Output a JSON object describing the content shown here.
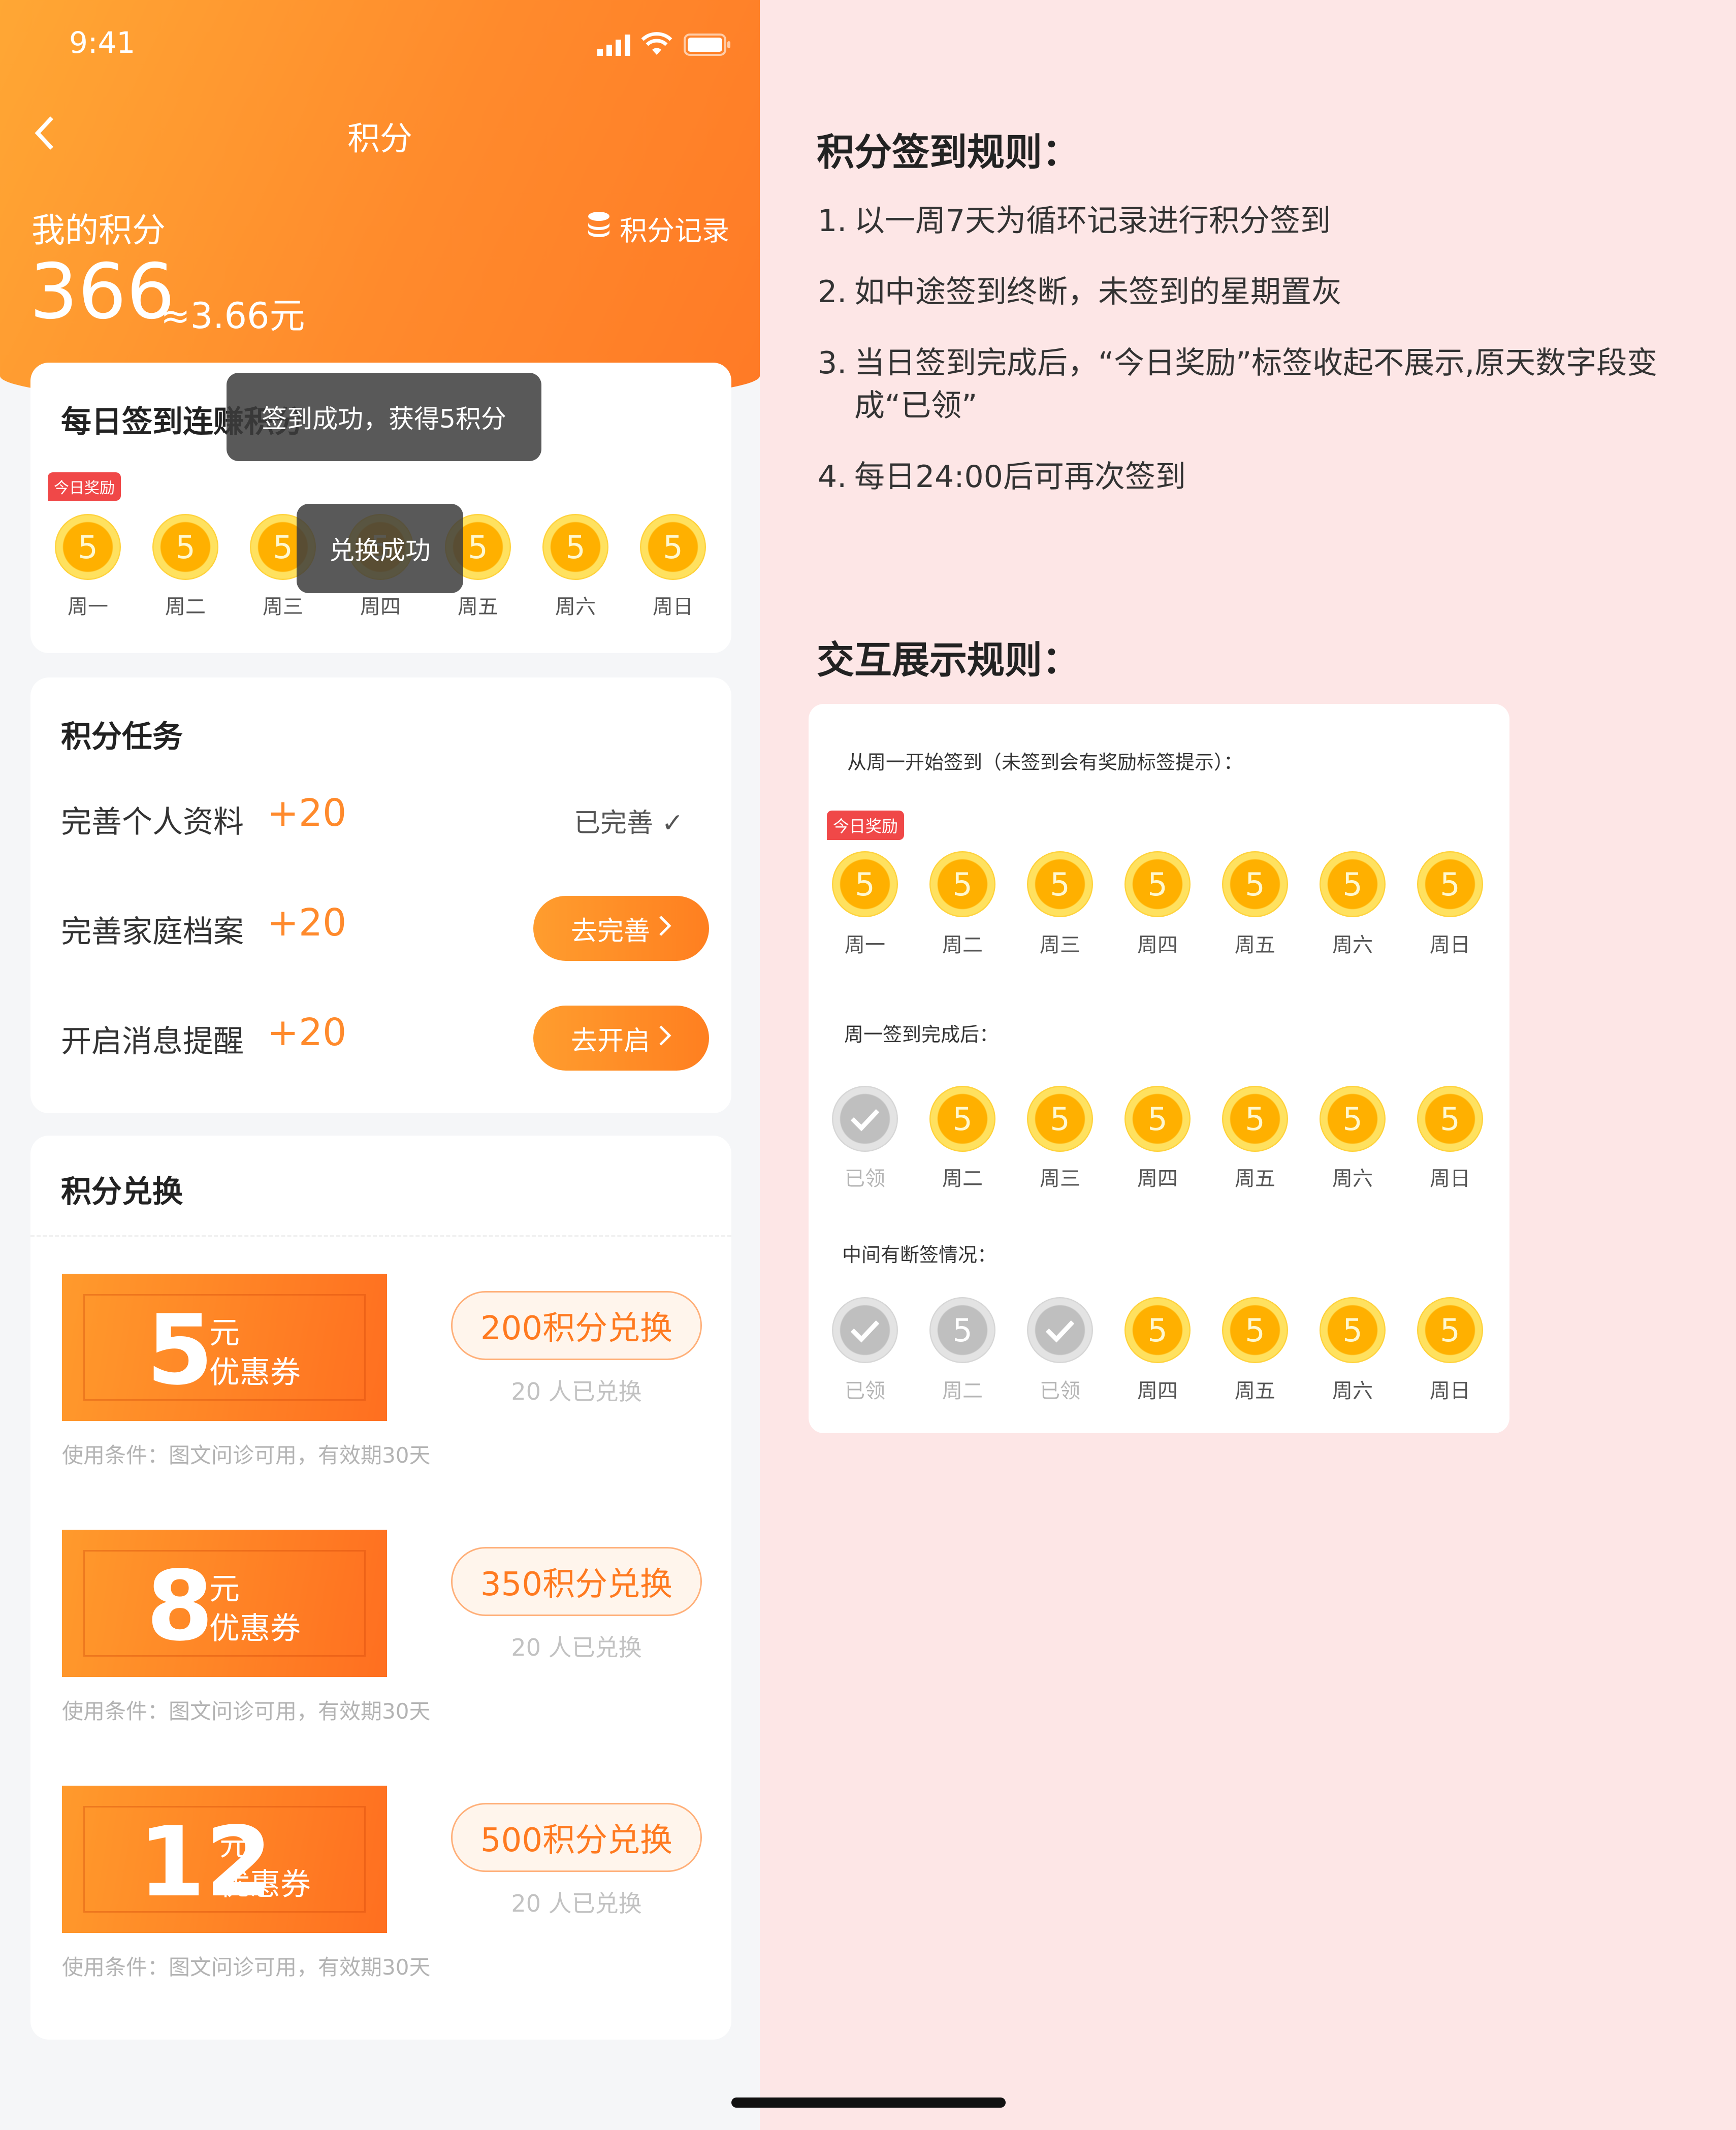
{
  "status_bar": {
    "time": "9:41"
  },
  "nav": {
    "title": "积分"
  },
  "points": {
    "label": "我的积分",
    "value": "366",
    "equiv": "≈3.66元",
    "record_link": "积分记录"
  },
  "daily": {
    "title": "每日签到连赚积分",
    "tag": "今日奖励",
    "days": [
      {
        "label": "周一",
        "coin": "5"
      },
      {
        "label": "周二",
        "coin": "5"
      },
      {
        "label": "周三",
        "coin": "5"
      },
      {
        "label": "周四",
        "coin": "5"
      },
      {
        "label": "周五",
        "coin": "5"
      },
      {
        "label": "周六",
        "coin": "5"
      },
      {
        "label": "周日",
        "coin": "5"
      }
    ]
  },
  "toasts": {
    "signin": "签到成功，获得5积分",
    "exchange": "兑换成功"
  },
  "tasks": {
    "title": "积分任务",
    "items": [
      {
        "name": "完善个人资料",
        "points": "+20",
        "status": "已完善 ✓"
      },
      {
        "name": "完善家庭档案",
        "points": "+20",
        "button": "去完善"
      },
      {
        "name": "开启消息提醒",
        "points": "+20",
        "button": "去开启"
      }
    ]
  },
  "exchange": {
    "title": "积分兑换",
    "coupons": [
      {
        "amount": "5",
        "unit": "元",
        "kind": "优惠券",
        "button": "200积分兑换",
        "count": "20 人已兑换",
        "condition": "使用条件：图文问诊可用，有效期30天"
      },
      {
        "amount": "8",
        "unit": "元",
        "kind": "优惠券",
        "button": "350积分兑换",
        "count": "20 人已兑换",
        "condition": "使用条件：图文问诊可用，有效期30天"
      },
      {
        "amount": "12",
        "unit": "元",
        "kind": "优惠券",
        "button": "500积分兑换",
        "count": "20 人已兑换",
        "condition": "使用条件：图文问诊可用，有效期30天"
      }
    ]
  },
  "rules": {
    "title": "积分签到规则：",
    "items": [
      {
        "num": "1.",
        "text": "以一周7天为循环记录进行积分签到"
      },
      {
        "num": "2.",
        "text": "如中途签到终断，未签到的星期置灰"
      },
      {
        "num": "3.",
        "text": "当日签到完成后，“今日奖励”标签收起不展示,原天数字段变",
        "text2": "成“已领”"
      },
      {
        "num": "4.",
        "text": "每日24:00后可再次签到"
      }
    ]
  },
  "interaction": {
    "title": "交互展示规则：",
    "sections": [
      {
        "caption": "从周一开始签到（未签到会有奖励标签提示）：",
        "tag": "今日奖励",
        "days": [
          {
            "label": "周一",
            "coin": "5",
            "state": "gold"
          },
          {
            "label": "周二",
            "coin": "5",
            "state": "gold"
          },
          {
            "label": "周三",
            "coin": "5",
            "state": "gold"
          },
          {
            "label": "周四",
            "coin": "5",
            "state": "gold"
          },
          {
            "label": "周五",
            "coin": "5",
            "state": "gold"
          },
          {
            "label": "周六",
            "coin": "5",
            "state": "gold"
          },
          {
            "label": "周日",
            "coin": "5",
            "state": "gold"
          }
        ]
      },
      {
        "caption": "周一签到完成后：",
        "days": [
          {
            "label": "已领",
            "coin": "",
            "state": "done"
          },
          {
            "label": "周二",
            "coin": "5",
            "state": "gold"
          },
          {
            "label": "周三",
            "coin": "5",
            "state": "gold"
          },
          {
            "label": "周四",
            "coin": "5",
            "state": "gold"
          },
          {
            "label": "周五",
            "coin": "5",
            "state": "gold"
          },
          {
            "label": "周六",
            "coin": "5",
            "state": "gold"
          },
          {
            "label": "周日",
            "coin": "5",
            "state": "gold"
          }
        ]
      },
      {
        "caption": "中间有断签情况：",
        "days": [
          {
            "label": "已领",
            "coin": "",
            "state": "done"
          },
          {
            "label": "周二",
            "coin": "5",
            "state": "missed"
          },
          {
            "label": "已领",
            "coin": "",
            "state": "done"
          },
          {
            "label": "周四",
            "coin": "5",
            "state": "gold"
          },
          {
            "label": "周五",
            "coin": "5",
            "state": "gold"
          },
          {
            "label": "周六",
            "coin": "5",
            "state": "gold"
          },
          {
            "label": "周日",
            "coin": "5",
            "state": "gold"
          }
        ]
      }
    ]
  },
  "colors": {
    "brand": "#ff8a2c",
    "brand_dark": "#ff6f20",
    "tag_red": "#f04848",
    "bg_right": "#fde6e6"
  }
}
